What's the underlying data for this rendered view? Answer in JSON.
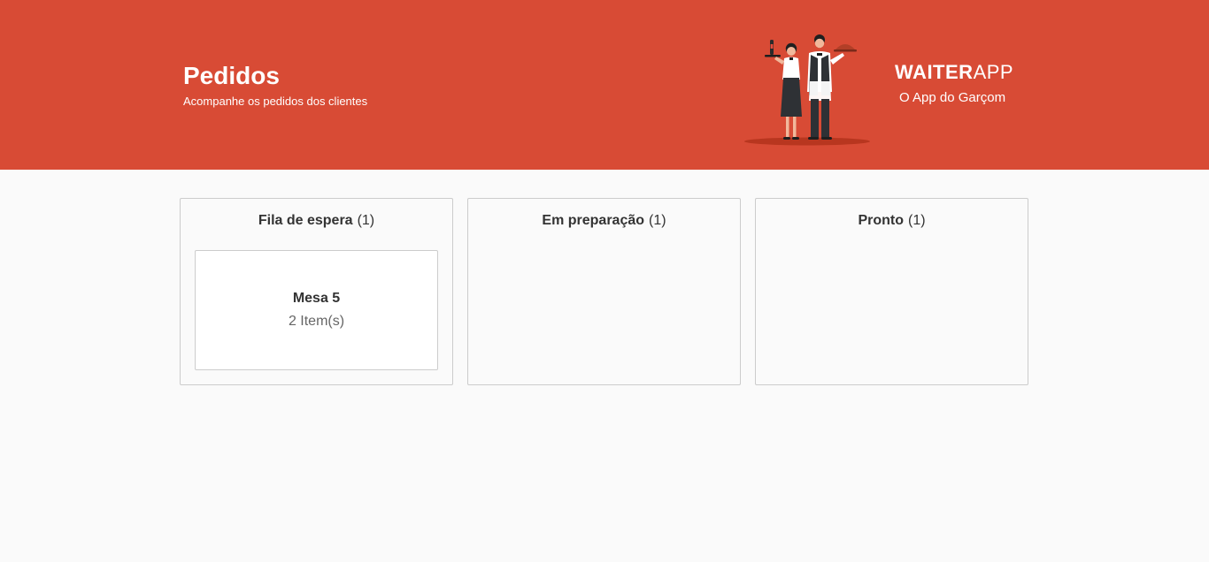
{
  "header": {
    "title": "Pedidos",
    "subtitle": "Acompanhe os pedidos dos clientes",
    "brand_strong": "WAITER",
    "brand_light": "APP",
    "brand_tagline": "O App do Garçom"
  },
  "columns": [
    {
      "title": "Fila de espera",
      "count": "(1)",
      "orders": [
        {
          "table": "Mesa 5",
          "items": "2 Item(s)"
        }
      ]
    },
    {
      "title": "Em preparação",
      "count": "(1)",
      "orders": []
    },
    {
      "title": "Pronto",
      "count": "(1)",
      "orders": []
    }
  ],
  "colors": {
    "header_bg": "#d84b35",
    "page_bg": "#fafafa",
    "border": "#cccccc"
  }
}
